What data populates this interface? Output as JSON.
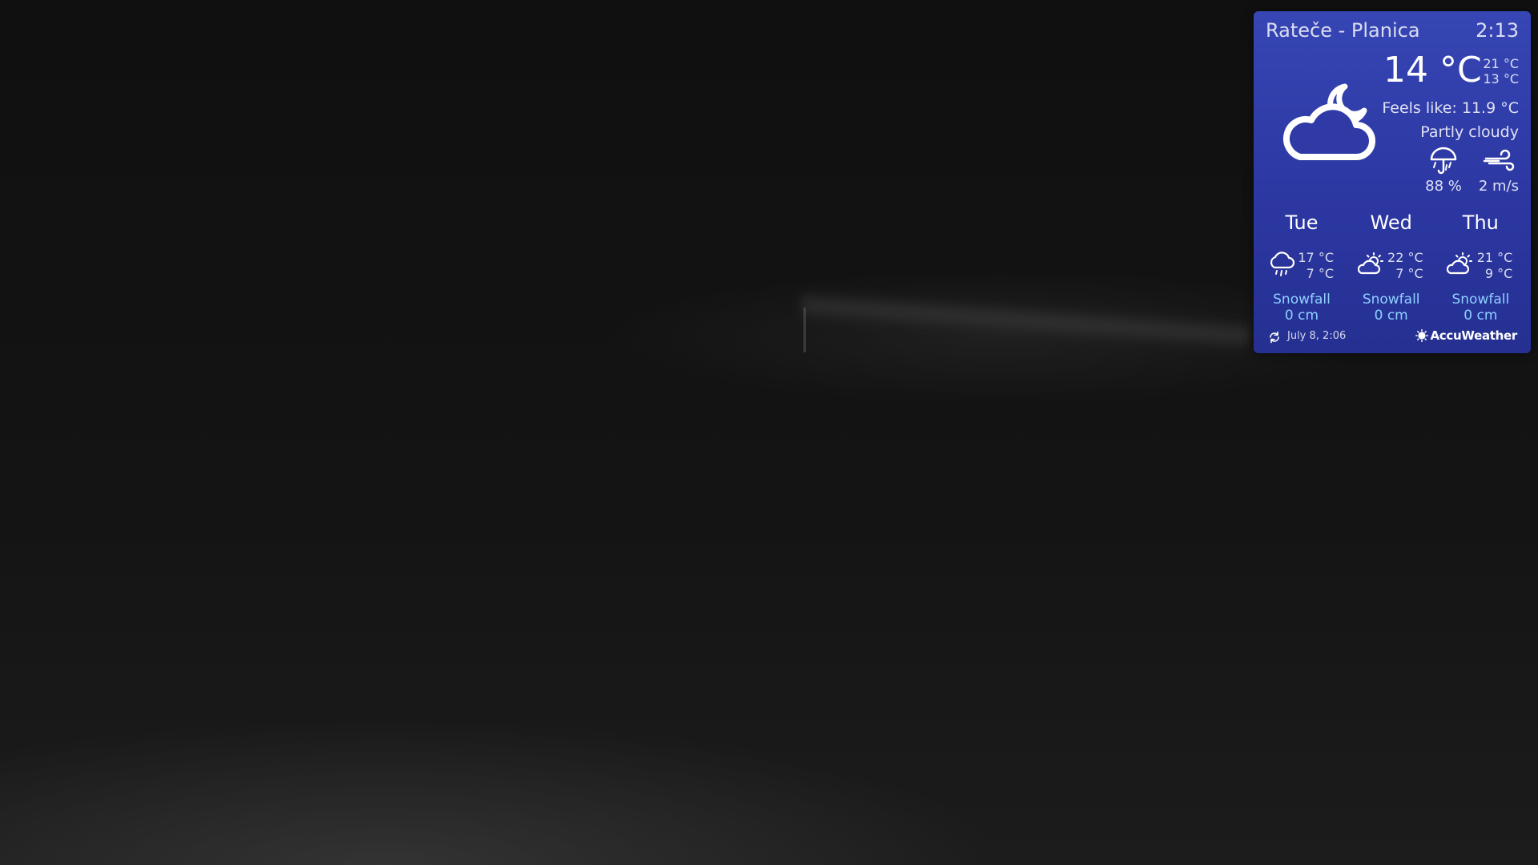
{
  "widget": {
    "location": "Rateče - Planica",
    "time": "2:13",
    "current": {
      "icon": "partly-cloudy-night-icon",
      "temperature": "14 °C",
      "high": "21 °C",
      "low": "13 °C",
      "feels_like": "Feels like: 11.9 °C",
      "condition": "Partly cloudy",
      "precipitation": "88 %",
      "wind": "2 m/s"
    },
    "forecast": [
      {
        "day": "Tue",
        "icon": "rain-cloud-icon",
        "high": "17 °C",
        "low": "7 °C",
        "snow_label": "Snowfall",
        "snow_value": "0 cm"
      },
      {
        "day": "Wed",
        "icon": "partly-sunny-icon",
        "high": "22 °C",
        "low": "7 °C",
        "snow_label": "Snowfall",
        "snow_value": "0 cm"
      },
      {
        "day": "Thu",
        "icon": "partly-sunny-icon",
        "high": "21 °C",
        "low": "9 °C",
        "snow_label": "Snowfall",
        "snow_value": "0 cm"
      }
    ],
    "updated": "July  8, 2:06",
    "brand": "AccuWeather",
    "colors": {
      "panel": "#3646b4",
      "snow_text": "#8fd1ff"
    }
  }
}
